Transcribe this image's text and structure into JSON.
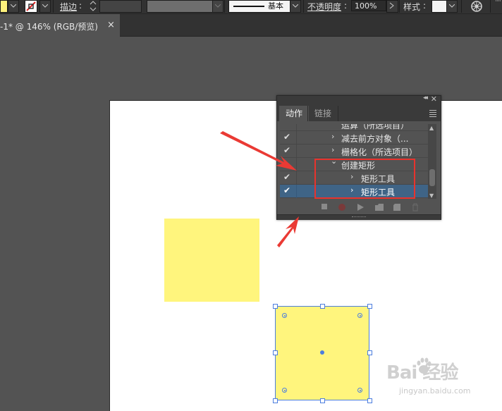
{
  "control_bar": {
    "stroke_label": "描边",
    "stroke_colon": ":",
    "brush_label": "基本",
    "opacity_label": "不透明度",
    "opacity_colon": ":",
    "opacity_value": "100%",
    "style_label": "样式",
    "style_colon": ":"
  },
  "document_tab": {
    "title": "-1* @ 146% (RGB/预览)",
    "close": "×"
  },
  "actions_panel": {
    "tabs": [
      "动作",
      "链接"
    ],
    "rows": [
      {
        "check": "",
        "arrow": "",
        "label": "运算（所选项目）"
      },
      {
        "check": "✔",
        "arrow": "›",
        "label": "减去前方对象（..."
      },
      {
        "check": "✔",
        "arrow": "›",
        "label": "栅格化（所选项目）"
      },
      {
        "check": "",
        "arrow": "⌄",
        "label": "创建矩形"
      },
      {
        "check": "✔",
        "arrow": "›",
        "label": "矩形工具"
      },
      {
        "check": "✔",
        "arrow": "›",
        "label": "矩形工具"
      }
    ],
    "selected_row": 5
  },
  "colors": {
    "fill": "#fff57d",
    "selection": "#4c7ede",
    "annotation": "#e8332d"
  },
  "watermark": {
    "brand": "Bai  经验",
    "url": "jingyan.baidu.com"
  }
}
